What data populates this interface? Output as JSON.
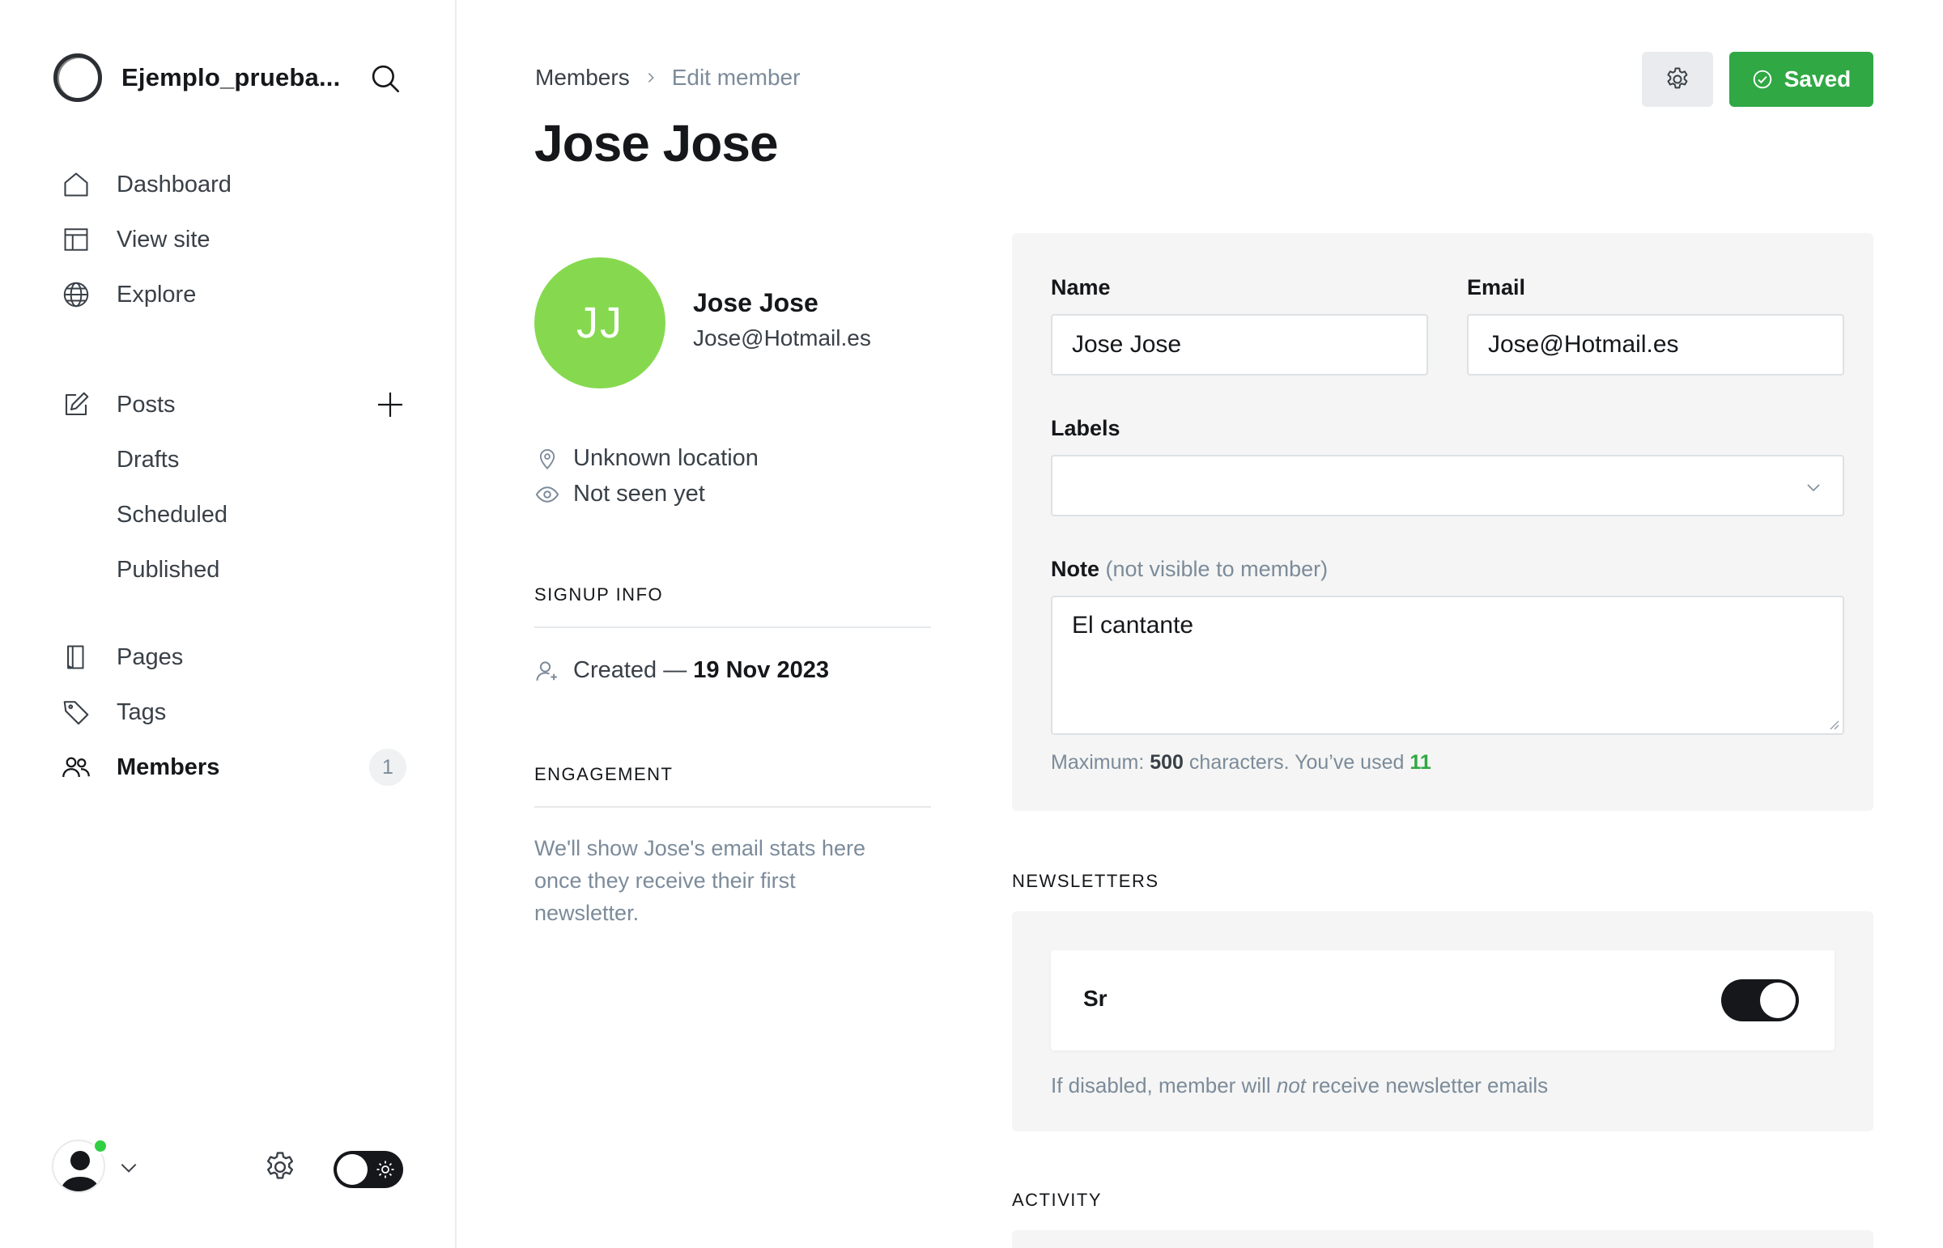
{
  "sidebar": {
    "site_name": "Ejemplo_prueba...",
    "nav_main": [
      {
        "label": "Dashboard",
        "icon": "home-icon"
      },
      {
        "label": "View site",
        "icon": "layout-icon"
      },
      {
        "label": "Explore",
        "icon": "globe-icon"
      }
    ],
    "posts": {
      "label": "Posts",
      "icon": "pen-icon"
    },
    "posts_sub": [
      "Drafts",
      "Scheduled",
      "Published"
    ],
    "nav_secondary": [
      {
        "label": "Pages",
        "icon": "page-icon"
      },
      {
        "label": "Tags",
        "icon": "tag-icon"
      }
    ],
    "members": {
      "label": "Members",
      "icon": "members-icon",
      "count": "1"
    }
  },
  "header": {
    "breadcrumb_parent": "Members",
    "breadcrumb_current": "Edit member",
    "title": "Jose Jose",
    "saved_label": "Saved"
  },
  "member": {
    "initials": "JJ",
    "avatar_color": "#86d94f",
    "name": "Jose Jose",
    "email": "Jose@Hotmail.es",
    "location": "Unknown location",
    "last_seen": "Not seen yet",
    "signup_heading": "SIGNUP INFO",
    "created_prefix": "Created —",
    "created_date": "19 Nov 2023",
    "engagement_heading": "ENGAGEMENT",
    "engagement_text": "We'll show Jose's email stats here once they receive their first newsletter."
  },
  "form": {
    "name_label": "Name",
    "name_value": "Jose Jose",
    "email_label": "Email",
    "email_value": "Jose@Hotmail.es",
    "labels_label": "Labels",
    "labels_value": "",
    "note_label": "Note",
    "note_hint": "(not visible to member)",
    "note_value": "El cantante",
    "char_prefix": "Maximum:",
    "char_max": "500",
    "char_middle": "characters. You’ve used",
    "char_used": "11"
  },
  "newsletters": {
    "heading": "NEWSLETTERS",
    "items": [
      {
        "name": "Sr",
        "subscribed": true
      }
    ],
    "help_before": "If disabled, member will",
    "help_em": "not",
    "help_after": "receive newsletter emails"
  },
  "activity": {
    "heading": "ACTIVITY"
  },
  "colors": {
    "accent_green": "#30a844",
    "avatar_green": "#86d94f",
    "online": "#30cf43"
  }
}
